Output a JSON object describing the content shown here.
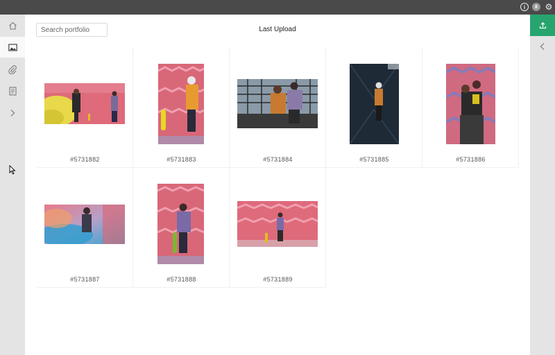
{
  "topbar": {
    "info_icon": "info-icon",
    "badge_text": "8",
    "settings_icon": "gear-icon"
  },
  "sidebar": {
    "items": [
      {
        "name": "home",
        "icon": "home-icon"
      },
      {
        "name": "images",
        "icon": "image-icon",
        "active": true
      },
      {
        "name": "attachments",
        "icon": "paperclip-icon"
      },
      {
        "name": "documents",
        "icon": "document-icon"
      },
      {
        "name": "expand",
        "icon": "chevron-right-icon"
      }
    ]
  },
  "right_panel": {
    "upload_icon": "upload-icon",
    "collapse_icon": "chevron-left-icon",
    "accent_color": "#27a56f"
  },
  "main": {
    "search": {
      "placeholder": "Search portfolio",
      "value": ""
    },
    "title": "Last Upload",
    "items": [
      {
        "id": "#5731882",
        "orientation": "landscape"
      },
      {
        "id": "#5731883",
        "orientation": "portrait"
      },
      {
        "id": "#5731884",
        "orientation": "landscape"
      },
      {
        "id": "#5731885",
        "orientation": "portrait"
      },
      {
        "id": "#5731886",
        "orientation": "portrait"
      },
      {
        "id": "#5731887",
        "orientation": "landscape"
      },
      {
        "id": "#5731888",
        "orientation": "portrait"
      },
      {
        "id": "#5731889",
        "orientation": "landscape"
      }
    ]
  }
}
